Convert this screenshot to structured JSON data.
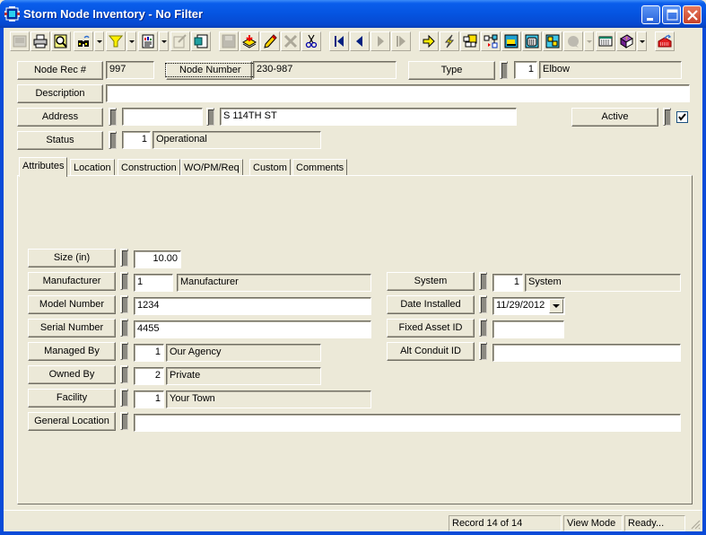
{
  "window": {
    "title": "Storm Node Inventory - No Filter",
    "controls": [
      "minimize",
      "maximize",
      "close"
    ]
  },
  "toolbar": {
    "buttons": [
      {
        "name": "grid-view-icon",
        "enabled": false
      },
      {
        "name": "print-icon",
        "enabled": true
      },
      {
        "name": "print-preview-icon",
        "enabled": true
      },
      {
        "name": "find-icon",
        "enabled": true,
        "dropdown": true
      },
      {
        "name": "filter-icon",
        "enabled": true,
        "dropdown": true
      },
      {
        "name": "report-icon",
        "enabled": true,
        "dropdown": true
      },
      {
        "name": "export-icon",
        "enabled": false
      },
      {
        "name": "copy-record-icon",
        "enabled": true
      },
      {
        "name": "save-icon",
        "enabled": false
      },
      {
        "name": "new-record-icon",
        "enabled": true
      },
      {
        "name": "edit-icon",
        "enabled": true
      },
      {
        "name": "delete-icon",
        "enabled": false
      },
      {
        "name": "cut-icon",
        "enabled": true
      },
      {
        "name": "first-record-icon",
        "enabled": true
      },
      {
        "name": "previous-record-icon",
        "enabled": true
      },
      {
        "name": "next-record-icon",
        "enabled": false
      },
      {
        "name": "last-record-icon",
        "enabled": false
      },
      {
        "name": "goto-icon",
        "enabled": true
      },
      {
        "name": "quick-action-icon",
        "enabled": true
      },
      {
        "name": "related-items-icon",
        "enabled": true
      },
      {
        "name": "connections-icon",
        "enabled": true
      },
      {
        "name": "work-order-icon",
        "enabled": true
      },
      {
        "name": "calculator-icon",
        "enabled": true
      },
      {
        "name": "map-icon",
        "enabled": true
      },
      {
        "name": "comments-icon",
        "enabled": false,
        "dropdown": true
      },
      {
        "name": "spreadsheet-icon",
        "enabled": true
      },
      {
        "name": "help-book-icon",
        "enabled": true,
        "dropdown": true
      },
      {
        "name": "exit-icon",
        "enabled": true
      }
    ]
  },
  "header": {
    "node_rec_label": "Node Rec #",
    "node_rec_value": "997",
    "node_number_label": "Node Number",
    "node_number_value": "230-987",
    "type_label": "Type",
    "type_code": "1",
    "type_value": "Elbow",
    "description_label": "Description",
    "description_value": "",
    "address_label": "Address",
    "address_number": "",
    "address_street": "S 114TH ST",
    "active_label": "Active",
    "active_checked": true,
    "status_label": "Status",
    "status_code": "1",
    "status_value": "Operational"
  },
  "tabs": [
    {
      "label": "Attributes",
      "active": true
    },
    {
      "label": "Location",
      "active": false
    },
    {
      "label": "Construction",
      "active": false
    },
    {
      "label": "WO/PM/Req",
      "active": false
    },
    {
      "label": "Custom",
      "active": false
    },
    {
      "label": "Comments",
      "active": false
    }
  ],
  "attributes": {
    "size_label": "Size (in)",
    "size_value": "10.00",
    "manufacturer_label": "Manufacturer",
    "manufacturer_code": "1",
    "manufacturer_value": "Manufacturer",
    "model_label": "Model Number",
    "model_value": "1234",
    "serial_label": "Serial Number",
    "serial_value": "4455",
    "managed_label": "Managed By",
    "managed_code": "1",
    "managed_value": "Our Agency",
    "owned_label": "Owned By",
    "owned_code": "2",
    "owned_value": "Private",
    "facility_label": "Facility",
    "facility_code": "1",
    "facility_value": "Your Town",
    "general_location_label": "General Location",
    "general_location_value": "",
    "system_label": "System",
    "system_code": "1",
    "system_value": "System",
    "date_installed_label": "Date Installed",
    "date_installed_value": "11/29/2012",
    "fixed_asset_label": "Fixed Asset ID",
    "fixed_asset_value": "",
    "alt_conduit_label": "Alt Conduit ID",
    "alt_conduit_value": ""
  },
  "statusbar": {
    "record": "Record 14 of 14",
    "mode": "View Mode",
    "state": "Ready..."
  },
  "colors": {
    "titlebar": "#0554E0",
    "face": "#ECE9D8",
    "shadow": "#716F64",
    "close_button": "#C8432A"
  }
}
